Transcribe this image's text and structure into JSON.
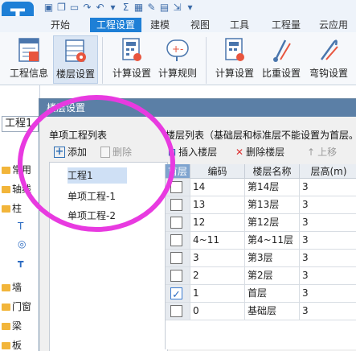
{
  "app": {
    "logo_letter": "T"
  },
  "quick_access": {
    "icons": [
      "save-icon",
      "copy-icon",
      "folder-open-icon",
      "redo-icon",
      "undo-icon",
      "arrow-down-icon",
      "sum-icon",
      "table-icon",
      "edit-icon",
      "grid-icon",
      "export-icon"
    ]
  },
  "ribbon_tabs": [
    "开始",
    "工程设置",
    "建模",
    "视图",
    "工具",
    "工程量",
    "云应用"
  ],
  "active_tab": "工程设置",
  "ribbon_buttons": [
    "工程信息",
    "楼层设置",
    "计算设置",
    "计算规则",
    "计算设置",
    "比重设置",
    "弯钩设置"
  ],
  "active_ribbon_button": "楼层设置",
  "left_panel": {
    "combo": "工程1",
    "items": [
      "常用",
      "轴线",
      "柱",
      "墙",
      "门窗",
      "梁",
      "板"
    ]
  },
  "dialog": {
    "title": "楼层设置",
    "project_list_title": "单项工程列表",
    "add_label": "添加",
    "delete_label": "删除",
    "projects": [
      "工程1",
      "单项工程-1",
      "单项工程-2"
    ],
    "floor_list_title": "楼层列表（基础层和标准层不能设置为首层。",
    "insert_floor": "插入楼层",
    "delete_floor": "删除楼层",
    "move_up": "上移",
    "columns": [
      "首层",
      "编码",
      "楼层名称",
      "层高(m)"
    ],
    "floors": [
      {
        "checked": false,
        "code": "14",
        "name": "第14层",
        "height": "3"
      },
      {
        "checked": false,
        "code": "13",
        "name": "第13层",
        "height": "3"
      },
      {
        "checked": false,
        "code": "12",
        "name": "第12层",
        "height": "3"
      },
      {
        "checked": false,
        "code": "4~11",
        "name": "第4~11层",
        "height": "3"
      },
      {
        "checked": false,
        "code": "3",
        "name": "第3层",
        "height": "3"
      },
      {
        "checked": false,
        "code": "2",
        "name": "第2层",
        "height": "3"
      },
      {
        "checked": true,
        "code": "1",
        "name": "首层",
        "height": "3"
      },
      {
        "checked": false,
        "code": "0",
        "name": "基础层",
        "height": "3"
      }
    ]
  },
  "colors": {
    "accent": "#1e7fd6",
    "dialog_title_bg": "#5b7fa6",
    "annotation": "#e83ae0"
  }
}
